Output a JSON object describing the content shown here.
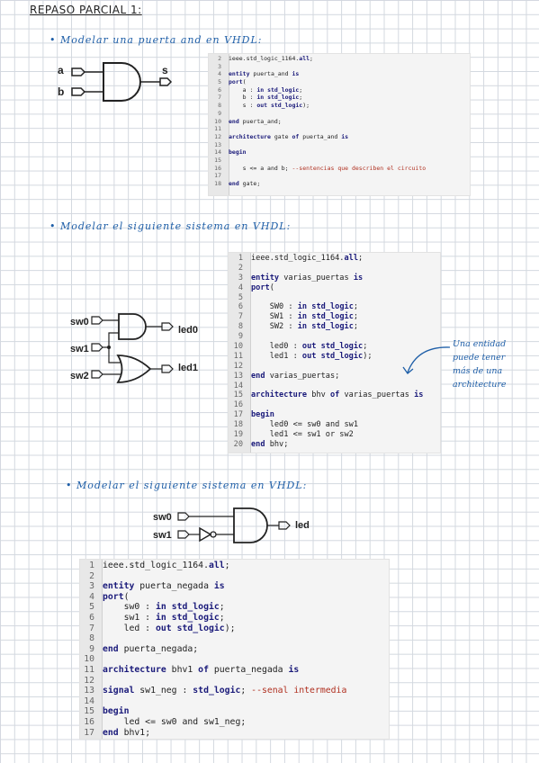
{
  "header": {
    "title": "REPASO PARCIAL 1:"
  },
  "sections": [
    {
      "bullet": "• Modelar una puerta and en VHDL:",
      "inputs": [
        "a",
        "b"
      ],
      "output": "s",
      "code": [
        {
          "n": "2",
          "t": "ieee.std_logic_1164.all;"
        },
        {
          "n": "3",
          "t": ""
        },
        {
          "n": "4",
          "t": "entity puerta_and is"
        },
        {
          "n": "5",
          "t": "port("
        },
        {
          "n": "6",
          "t": "    a : in std_logic;"
        },
        {
          "n": "7",
          "t": "    b : in std_logic;"
        },
        {
          "n": "8",
          "t": "    s : out std_logic);"
        },
        {
          "n": "9",
          "t": ""
        },
        {
          "n": "10",
          "t": "end puerta_and;"
        },
        {
          "n": "11",
          "t": ""
        },
        {
          "n": "12",
          "t": "architecture gate of puerta_and is"
        },
        {
          "n": "13",
          "t": ""
        },
        {
          "n": "14",
          "t": "begin"
        },
        {
          "n": "15",
          "t": ""
        },
        {
          "n": "16",
          "t": "    s <= a and b; --sentencias que describen el circuito"
        },
        {
          "n": "17",
          "t": ""
        },
        {
          "n": "18",
          "t": "end gate;"
        }
      ]
    },
    {
      "bullet": "• Modelar el siguiente sistema en VHDL:",
      "inputs": [
        "sw0",
        "sw1",
        "sw2"
      ],
      "outputs": [
        "led0",
        "led1"
      ],
      "note": [
        "Una entidad",
        "puede tener",
        "más de una",
        "architecture"
      ],
      "code": [
        {
          "n": "1",
          "t": "ieee.std_logic_1164.all;"
        },
        {
          "n": "2",
          "t": ""
        },
        {
          "n": "3",
          "t": "entity varias_puertas is"
        },
        {
          "n": "4",
          "t": "port("
        },
        {
          "n": "5",
          "t": ""
        },
        {
          "n": "6",
          "t": "    SW0 : in std_logic;"
        },
        {
          "n": "7",
          "t": "    SW1 : in std_logic;"
        },
        {
          "n": "8",
          "t": "    SW2 : in std_logic;"
        },
        {
          "n": "9",
          "t": ""
        },
        {
          "n": "10",
          "t": "    led0 : out std_logic;"
        },
        {
          "n": "11",
          "t": "    led1 : out std_logic);"
        },
        {
          "n": "12",
          "t": ""
        },
        {
          "n": "13",
          "t": "end varias_puertas;"
        },
        {
          "n": "14",
          "t": ""
        },
        {
          "n": "15",
          "t": "architecture bhv of varias_puertas is"
        },
        {
          "n": "16",
          "t": ""
        },
        {
          "n": "17",
          "t": "begin"
        },
        {
          "n": "18",
          "t": "    led0 <= sw0 and sw1"
        },
        {
          "n": "19",
          "t": "    led1 <= sw1 or sw2"
        },
        {
          "n": "20",
          "t": "end bhv;"
        }
      ]
    },
    {
      "bullet": "• Modelar el siguiente sistema en VHDL:",
      "inputs": [
        "sw0",
        "sw1"
      ],
      "output": "led",
      "code": [
        {
          "n": "1",
          "t": "ieee.std_logic_1164.all;"
        },
        {
          "n": "2",
          "t": ""
        },
        {
          "n": "3",
          "t": "entity puerta_negada is"
        },
        {
          "n": "4",
          "t": "port("
        },
        {
          "n": "5",
          "t": "    sw0 : in std_logic;"
        },
        {
          "n": "6",
          "t": "    sw1 : in std_logic;"
        },
        {
          "n": "7",
          "t": "    led : out std_logic);"
        },
        {
          "n": "8",
          "t": ""
        },
        {
          "n": "9",
          "t": "end puerta_negada;"
        },
        {
          "n": "10",
          "t": ""
        },
        {
          "n": "11",
          "t": "architecture bhv1 of puerta_negada is"
        },
        {
          "n": "12",
          "t": ""
        },
        {
          "n": "13",
          "t": "signal sw1_neg : std_logic; --senal intermedia"
        },
        {
          "n": "14",
          "t": ""
        },
        {
          "n": "15",
          "t": "begin"
        },
        {
          "n": "16",
          "t": "    led <= sw0 and sw1_neg;"
        },
        {
          "n": "17",
          "t": "end bhv1;"
        }
      ]
    }
  ]
}
